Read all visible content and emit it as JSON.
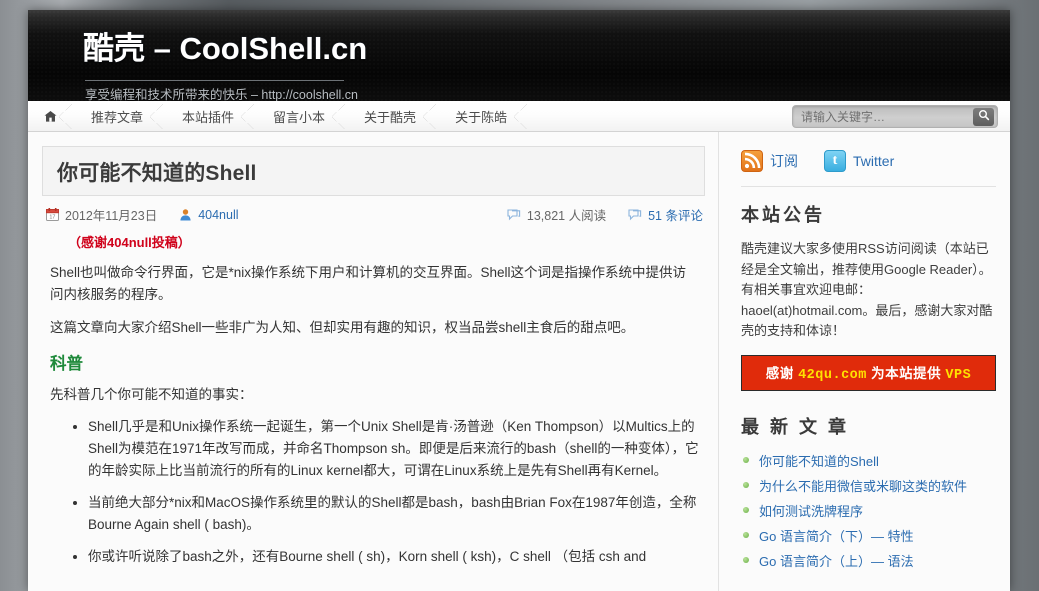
{
  "header": {
    "site_title_cn": "酷壳",
    "site_title_sep": " – ",
    "site_title_en": "CoolShell.cn",
    "site_description": "享受编程和技术所带来的快乐 – http://coolshell.cn"
  },
  "nav": {
    "home_icon": "home-icon",
    "items": [
      {
        "label": "推荐文章"
      },
      {
        "label": "本站插件"
      },
      {
        "label": "留言小本"
      },
      {
        "label": "关于酷壳"
      },
      {
        "label": "关于陈皓"
      }
    ]
  },
  "search": {
    "placeholder": "请输入关键字…",
    "value": "",
    "button_icon": "search-icon"
  },
  "post": {
    "title": "你可能不知道的Shell",
    "date_icon": "calendar-icon",
    "date": "2012年11月23日",
    "author_icon": "user-icon",
    "author": "404null",
    "views_icon": "comment-bubble-icon",
    "views": "13,821 人阅读",
    "comments_icon": "comment-bubble-icon",
    "comments": "51 条评论",
    "notice": "（感谢404null投稿）",
    "paragraph_1": "Shell也叫做命令行界面，它是*nix操作系统下用户和计算机的交互界面。Shell这个词是指操作系统中提供访问内核服务的程序。",
    "paragraph_2": "这篇文章向大家介绍Shell一些非广为人知、但却实用有趣的知识，权当品尝shell主食后的甜点吧。",
    "section_heading": "科普",
    "paragraph_3": "先科普几个你可能不知道的事实：",
    "bullets": [
      "Shell几乎是和Unix操作系统一起诞生，第一个Unix Shell是肯·汤普逊（Ken Thompson）以Multics上的Shell为模范在1971年改写而成，并命名Thompson sh。即便是后来流行的bash（shell的一种变体），它的年龄实际上比当前流行的所有的Linux kernel都大，可谓在Linux系统上是先有Shell再有Kernel。",
      "当前绝大部分*nix和MacOS操作系统里的默认的Shell都是bash，bash由Brian Fox在1987年创造，全称Bourne Again shell ( bash)。",
      "你或许听说除了bash之外，还有Bourne shell ( sh)，Korn shell ( ksh)，C shell （包括 csh and"
    ]
  },
  "sidebar": {
    "rss_icon": "rss-icon",
    "rss_label": "订阅",
    "twitter_icon": "twitter-icon",
    "twitter_label": "Twitter",
    "announce_heading": "本站公告",
    "announce_text": "酷壳建议大家多使用RSS访问阅读（本站已经是全文输出，推荐使用Google Reader）。有相关事宜欢迎电邮：haoel(at)hotmail.com。最后，感谢大家对酷壳的支持和体谅！",
    "vps_banner": {
      "prefix": "感谢 ",
      "sponsor": "42qu.com",
      "middle": " 为本站提供 ",
      "suffix": "VPS"
    },
    "latest_heading": "最 新 文 章",
    "latest_items": [
      {
        "label": "你可能不知道的Shell"
      },
      {
        "label": "为什么不能用微信或米聊这类的软件"
      },
      {
        "label": "如何测试洗牌程序"
      },
      {
        "label": "Go 语言简介（下）— 特性"
      },
      {
        "label": "Go 语言简介（上）— 语法"
      }
    ]
  },
  "colors": {
    "accent_link": "#2b6cb0",
    "section_green": "#1f8a3b",
    "notice_red": "#d0021b",
    "banner_red": "#e02b0b",
    "banner_yellow": "#ffe200",
    "header_dark": "#0d0d0d"
  }
}
